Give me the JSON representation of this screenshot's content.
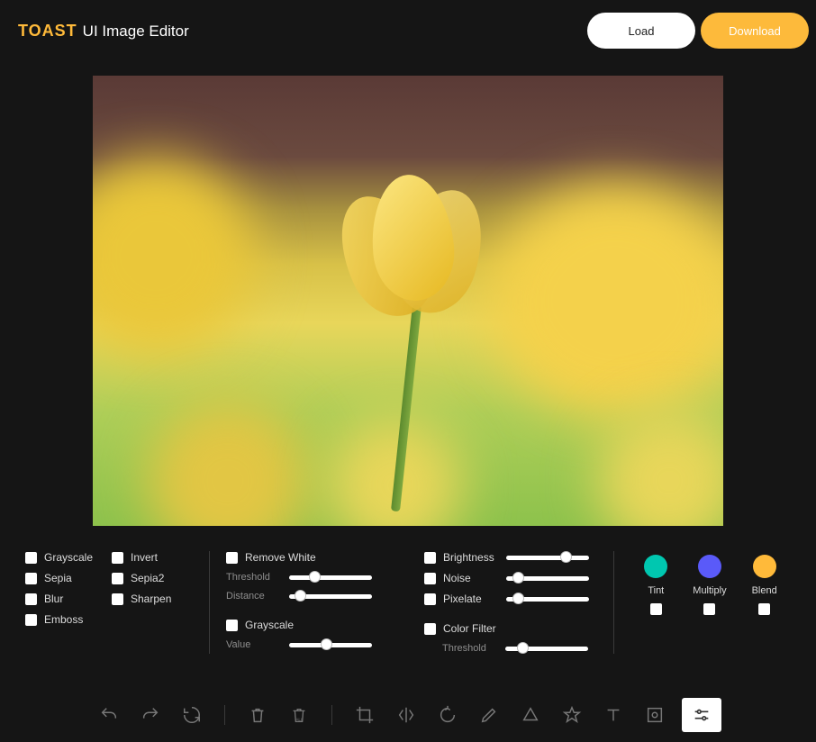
{
  "header": {
    "logo_toast": "TOAST",
    "logo_subtitle": "UI Image Editor",
    "load_label": "Load",
    "download_label": "Download"
  },
  "filters": {
    "col1": {
      "grayscale": "Grayscale",
      "sepia": "Sepia",
      "blur": "Blur",
      "emboss": "Emboss"
    },
    "col2": {
      "invert": "Invert",
      "sepia2": "Sepia2",
      "sharpen": "Sharpen"
    },
    "col3": {
      "remove_white": "Remove White",
      "threshold": "Threshold",
      "distance": "Distance",
      "grayscale": "Grayscale",
      "value": "Value"
    },
    "col4": {
      "brightness": "Brightness",
      "noise": "Noise",
      "pixelate": "Pixelate",
      "color_filter": "Color Filter",
      "threshold": "Threshold"
    },
    "col5": {
      "tint": "Tint",
      "multiply": "Multiply",
      "blend": "Blend"
    }
  },
  "colors": {
    "tint": "#00c7b0",
    "multiply": "#5a5af9",
    "blend": "#ffba3a"
  },
  "slider_positions": {
    "removewhite_threshold": 24,
    "removewhite_distance": 6,
    "grayscale_value": 38,
    "brightness": 65,
    "noise": 8,
    "pixelate": 8,
    "colorfilter_threshold": 14
  },
  "toolbar": {
    "items": [
      "undo",
      "redo",
      "reset",
      "delete",
      "delete-all",
      "crop",
      "flip",
      "rotate",
      "draw",
      "shape",
      "icon",
      "text",
      "mask",
      "filter"
    ],
    "active": "filter"
  }
}
